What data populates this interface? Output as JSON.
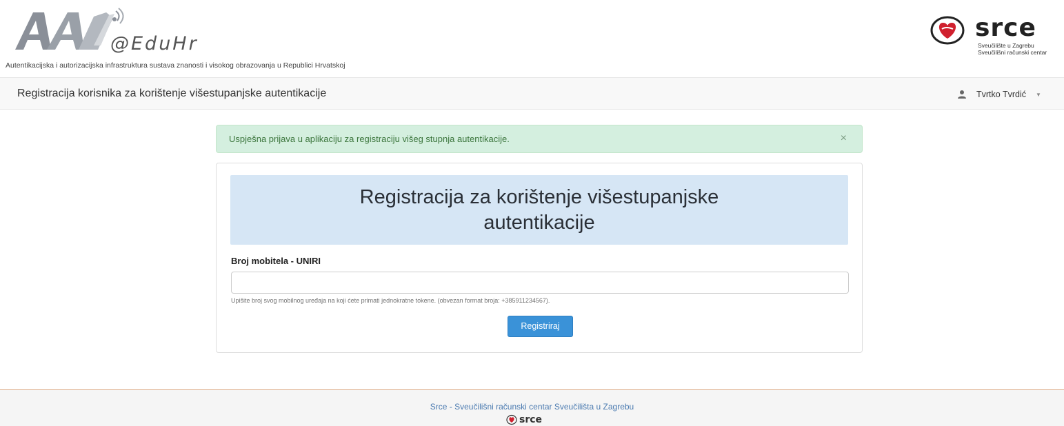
{
  "header": {
    "aai_logo_text": "@EduHr",
    "tagline": "Autentikacijska i autorizacijska infrastruktura sustava znanosti i visokog obrazovanja u Republici Hrvatskoj",
    "srce_logo_text": "srce",
    "srce_subtitle_1": "Sveučilište u Zagrebu",
    "srce_subtitle_2": "Sveučilišni računski centar"
  },
  "navbar": {
    "title": "Registracija korisnika za korištenje višestupanjske autentikacije",
    "user_name": "Tvrtko Tvrdić",
    "user_icon": "user-icon",
    "caret_icon": "caret-down-icon"
  },
  "alert": {
    "message": "Uspješna prijava u aplikaciju za registraciju višeg stupnja autentikacije.",
    "close_symbol": "×"
  },
  "form": {
    "heading": "Registracija za korištenje višestupanjske autentikacije",
    "phone_label": "Broj mobitela - UNIRI",
    "phone_value": "",
    "help_text": "Upišite broj svog mobilnog uređaja na koji ćete primati jednokratne tokene. (obvezan format broja: +385911234567).",
    "submit_label": "Registriraj"
  },
  "footer": {
    "text": "Srce - Sveučilišni računski centar Sveučilišta u Zagrebu",
    "logo_text": "srce"
  },
  "colors": {
    "primary_button": "#3a92d8",
    "alert_bg": "#d4efdf",
    "jumbotron_bg": "#d6e6f5",
    "srce_heart": "#d0202e"
  }
}
